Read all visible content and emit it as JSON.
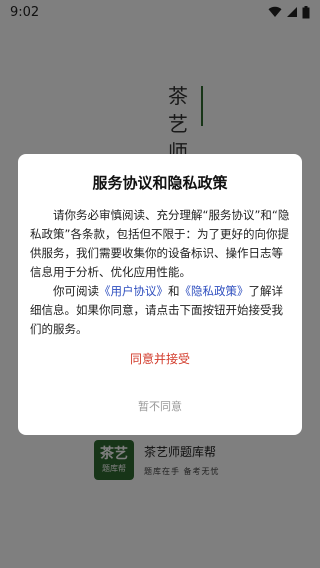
{
  "status_bar": {
    "time": "9:02"
  },
  "splash": {
    "title_chars": [
      "茶",
      "艺",
      "师"
    ],
    "accent_color": "#2e6b2f"
  },
  "brand": {
    "logo_line1": "茶艺",
    "logo_line2": "题库帮",
    "name": "茶艺师题库帮",
    "slogan": "题库在手 备考无忧"
  },
  "dialog": {
    "title": "服务协议和隐私政策",
    "para1": "请你务必审慎阅读、充分理解“服务协议”和“隐私政策”各条款，包括但不限于：为了更好的向你提供服务，我们需要收集你的设备标识、操作日志等信息用于分析、优化应用性能。",
    "para2_prefix": "你可阅读",
    "link_user_agreement": "《用户协议》",
    "para2_and": "和",
    "link_privacy_policy": "《隐私政策》",
    "para2_suffix": "了解详细信息。如果你同意，请点击下面按钮开始接受我们的服务。",
    "agree_label": "同意并接受",
    "disagree_label": "暂不同意",
    "link_color": "#2f4fbf",
    "agree_color": "#d23a2a"
  }
}
